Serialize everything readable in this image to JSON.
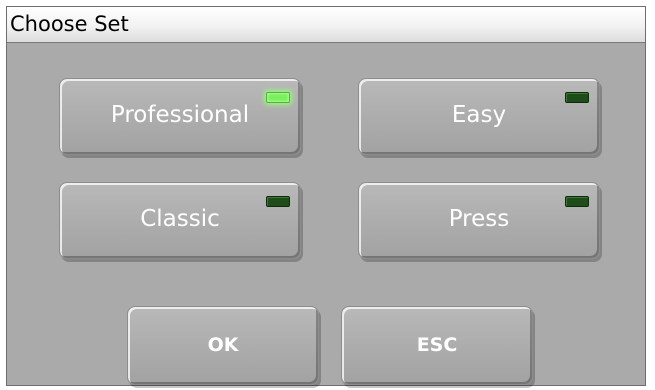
{
  "window": {
    "title": "Choose Set"
  },
  "sets": [
    {
      "label": "Professional",
      "active": true
    },
    {
      "label": "Easy",
      "active": false
    },
    {
      "label": "Classic",
      "active": false
    },
    {
      "label": "Press",
      "active": false
    }
  ],
  "actions": {
    "ok_label": "OK",
    "esc_label": "ESC"
  },
  "colors": {
    "led_on": "#79f05a",
    "led_off": "#1e4d1a",
    "panel": "#aaaaaa",
    "button_text": "#ffffff"
  }
}
